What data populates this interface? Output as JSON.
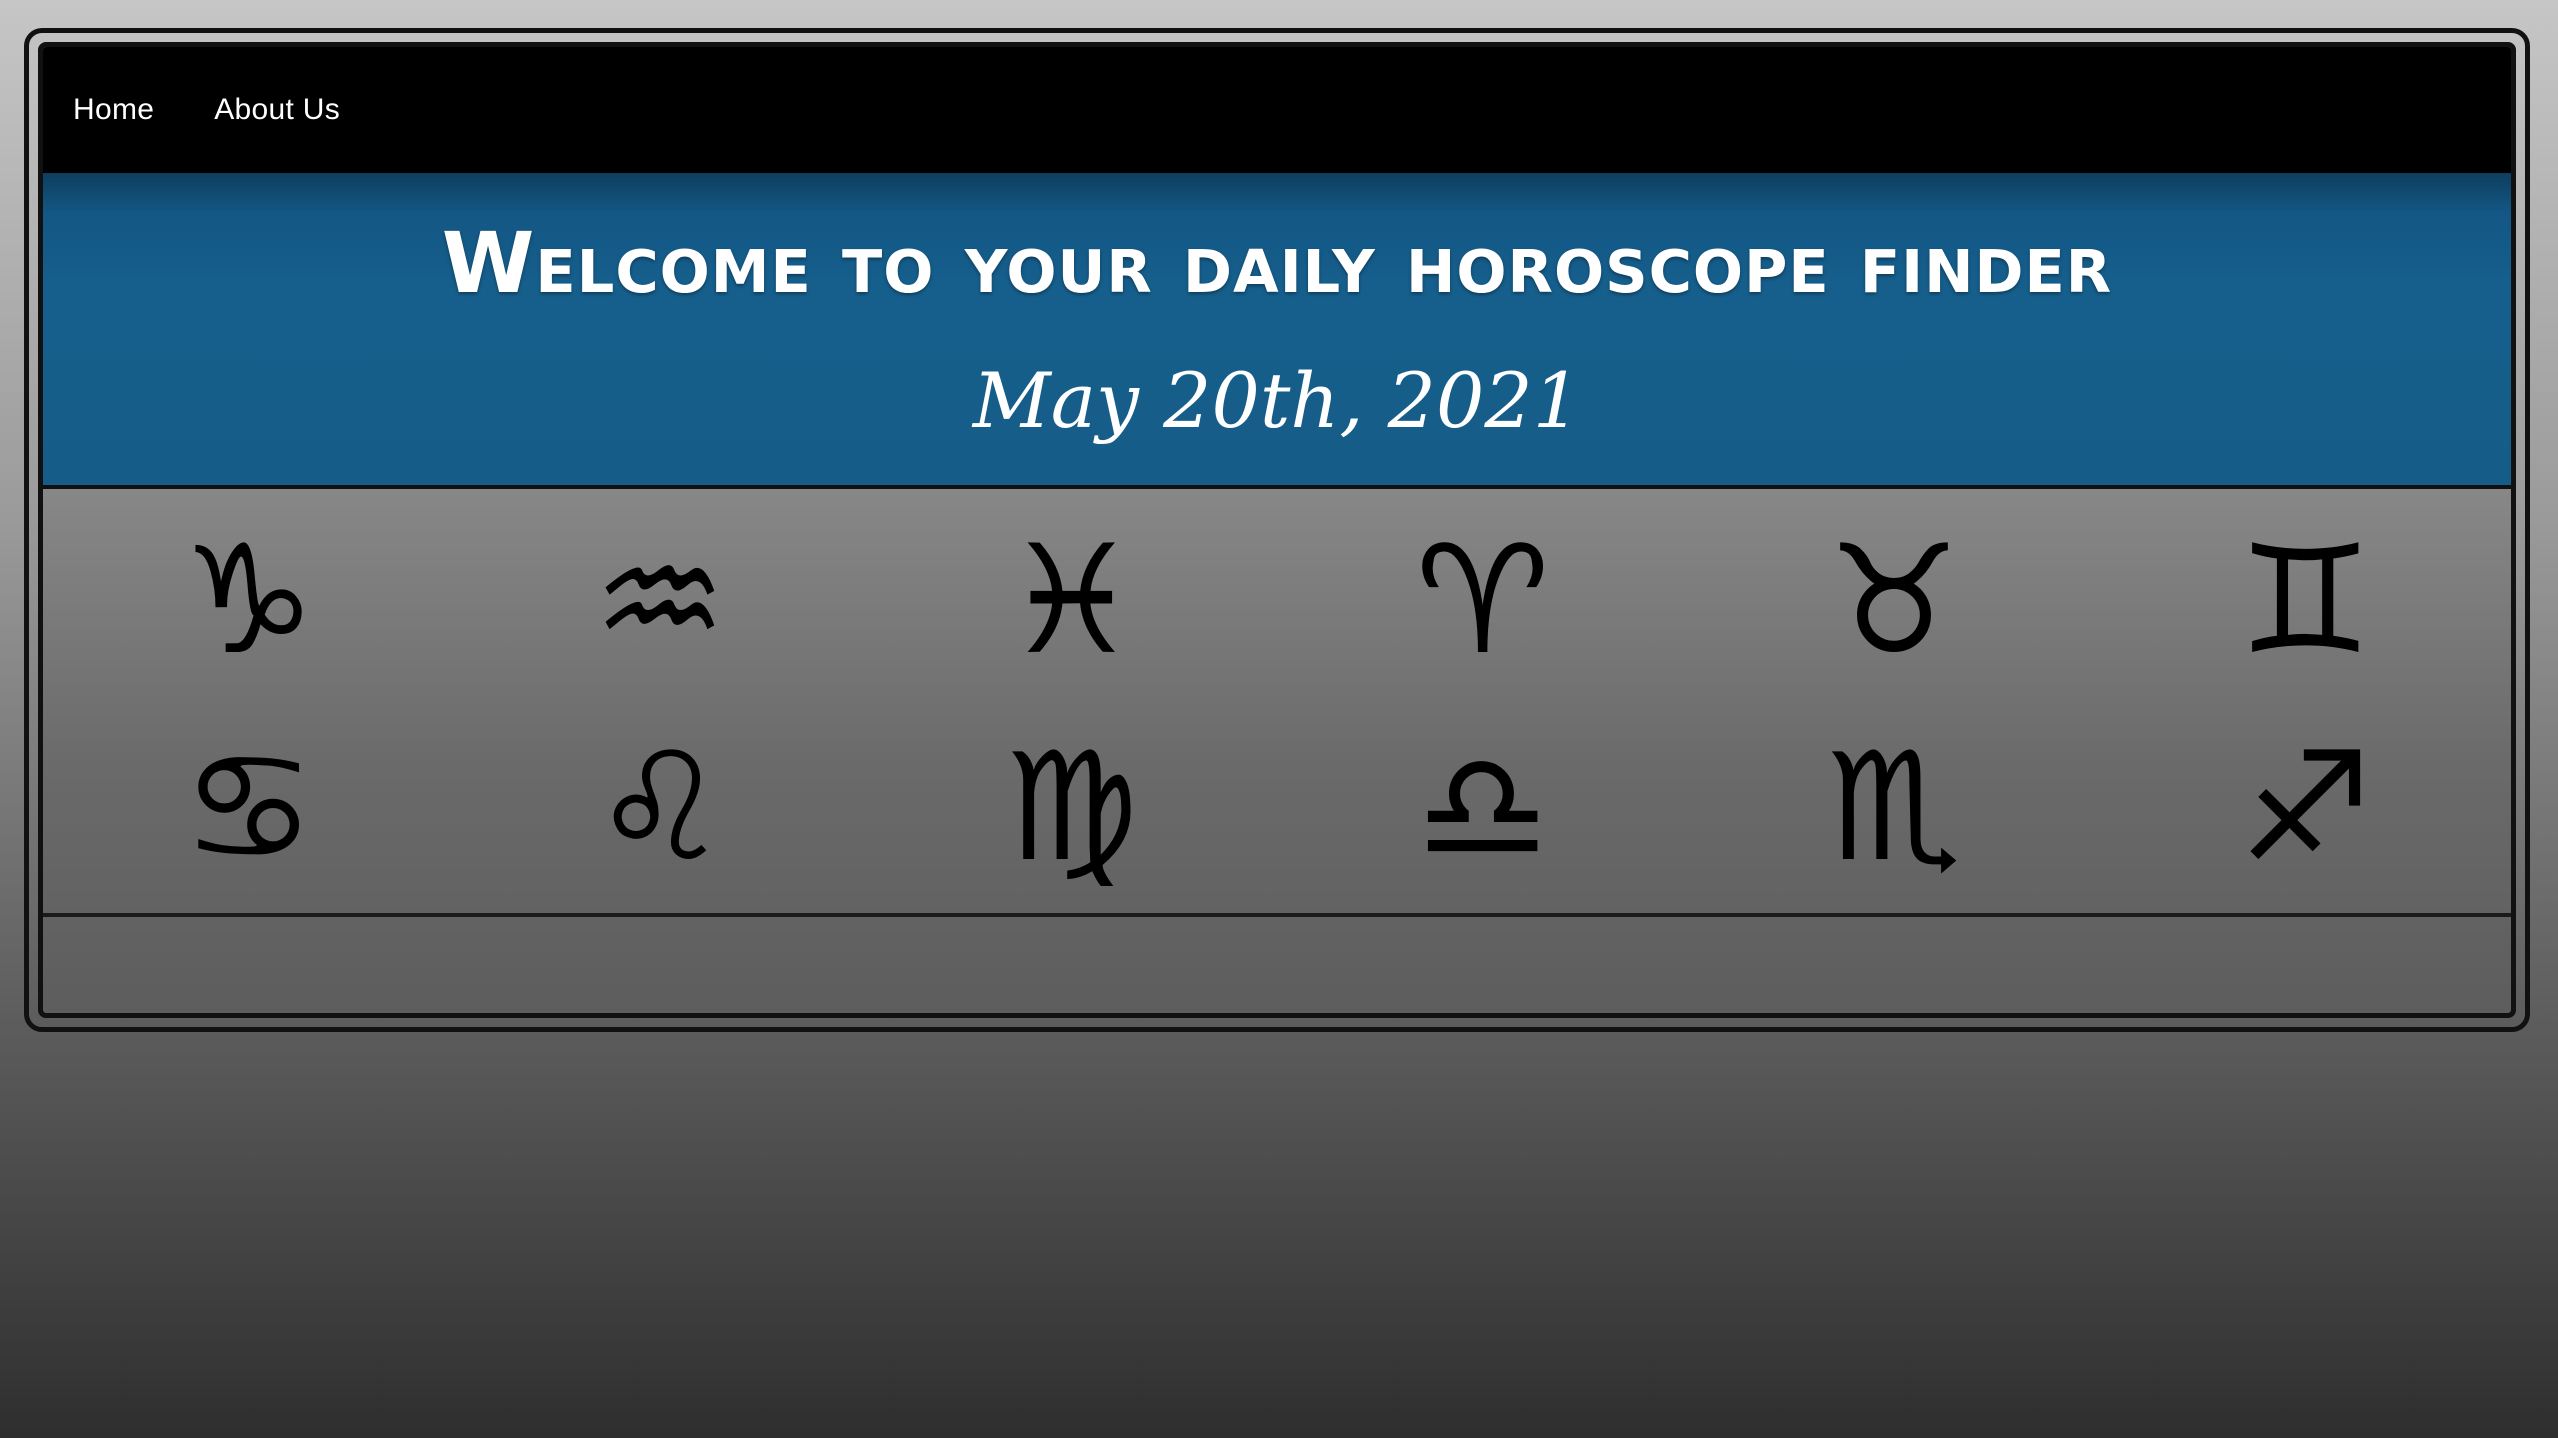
{
  "nav": {
    "items": [
      {
        "label": "Home"
      },
      {
        "label": "About Us"
      }
    ]
  },
  "header": {
    "title": "Welcome to your daily horoscope finder",
    "date": "May 20th, 2021"
  },
  "zodiac": {
    "signs": [
      {
        "name": "capricorn",
        "glyph": "♑"
      },
      {
        "name": "aquarius",
        "glyph": "♒"
      },
      {
        "name": "pisces",
        "glyph": "♓"
      },
      {
        "name": "aries",
        "glyph": "♈"
      },
      {
        "name": "taurus",
        "glyph": "♉"
      },
      {
        "name": "gemini",
        "glyph": "♊"
      },
      {
        "name": "cancer",
        "glyph": "♋"
      },
      {
        "name": "leo",
        "glyph": "♌"
      },
      {
        "name": "virgo",
        "glyph": "♍"
      },
      {
        "name": "libra",
        "glyph": "♎"
      },
      {
        "name": "scorpio",
        "glyph": "♏"
      },
      {
        "name": "sagittarius",
        "glyph": "♐"
      }
    ]
  },
  "colors": {
    "navbar": "#000000",
    "header": "#165c88",
    "text": "#ffffff"
  }
}
